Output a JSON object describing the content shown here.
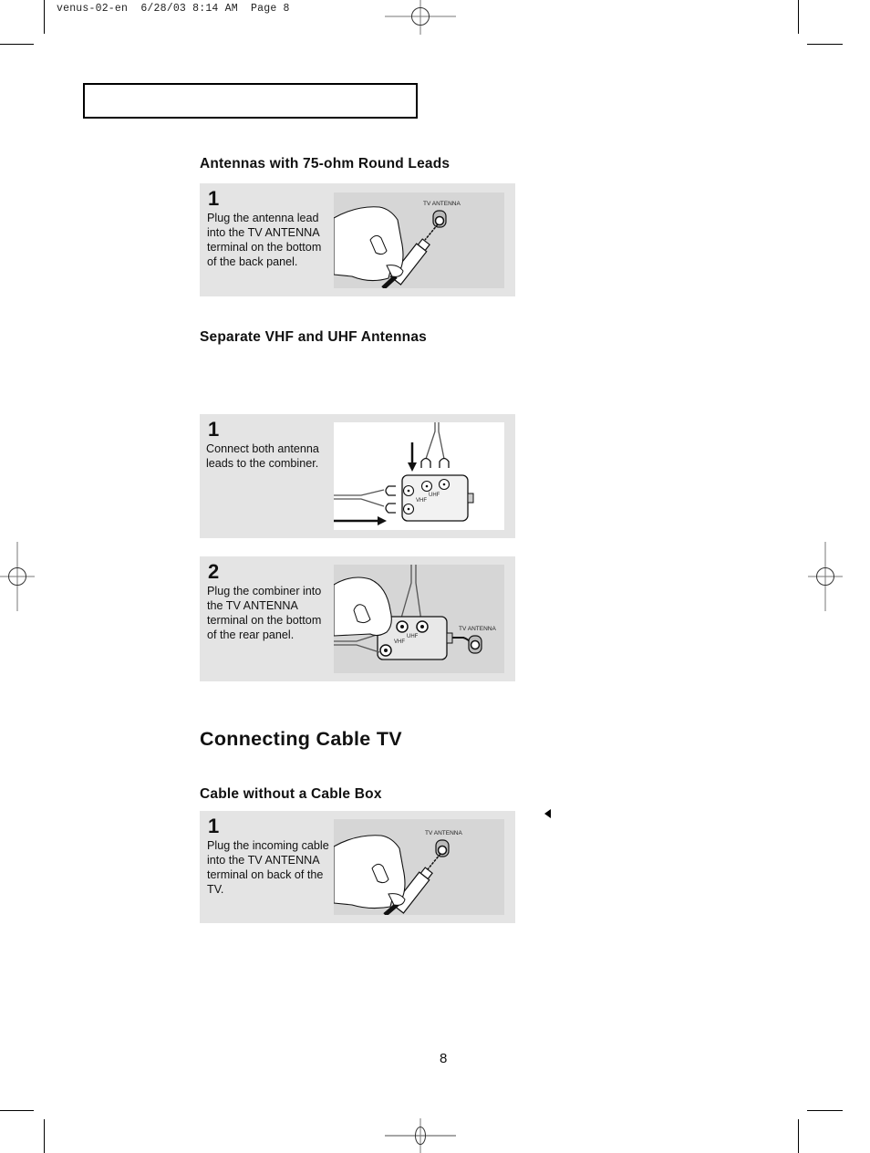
{
  "slug": "venus-02-en  6/28/03 8:14 AM  Page 8",
  "sections": {
    "antennas_75ohm": {
      "title": "Antennas with 75-ohm Round Leads",
      "steps": [
        {
          "number": "1",
          "text": "Plug the antenna lead into the TV ANTENNA terminal on the bottom of the back panel.",
          "illustration_label": "TV ANTENNA"
        }
      ]
    },
    "separate_vhf_uhf": {
      "title": "Separate VHF and UHF Antennas",
      "steps": [
        {
          "number": "1",
          "text": "Connect both antenna leads to the combiner.",
          "labels": {
            "vhf": "VHF",
            "uhf": "UHF"
          }
        },
        {
          "number": "2",
          "text": "Plug the combiner into the TV ANTENNA terminal on the bottom of the rear panel.",
          "labels": {
            "vhf": "VHF",
            "uhf": "UHF",
            "tv_antenna": "TV ANTENNA"
          }
        }
      ]
    },
    "connecting_cable": {
      "title": "Connecting Cable TV",
      "subsections": [
        {
          "title": "Cable without a Cable Box",
          "steps": [
            {
              "number": "1",
              "text": "Plug the incoming cable into the TV ANTENNA terminal on back of the TV.",
              "illustration_label": "TV ANTENNA"
            }
          ]
        }
      ]
    }
  },
  "page_number": "8",
  "colors": {
    "step_background": "#e4e4e4",
    "illustration_background": "#d6d6d6",
    "text": "#111111"
  }
}
